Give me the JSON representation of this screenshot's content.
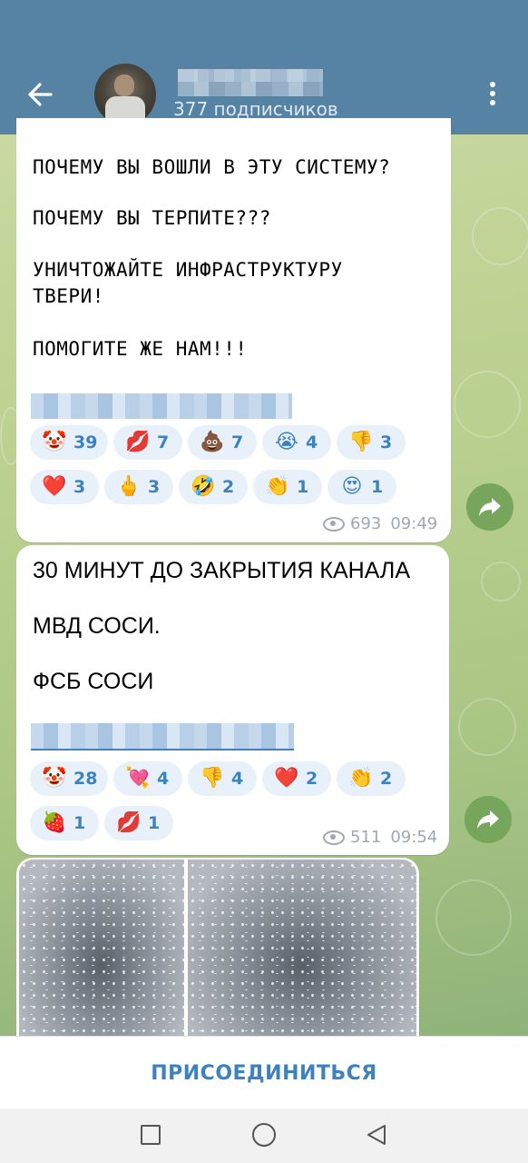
{
  "header": {
    "subscribers": "377 подписчиков",
    "back_icon": "arrow-left-icon",
    "menu_icon": "more-vertical-icon",
    "colors": {
      "header_bg": "#5682a3",
      "accent": "#3d82bf"
    }
  },
  "messages": [
    {
      "lines": [
        "ПОЧЕМУ ВЫ ВОШЛИ В ЭТУ СИСТЕМУ?",
        "ПОЧЕМУ ВЫ ТЕРПИТЕ???",
        "УНИЧТОЖАЙТЕ ИНФРАСТРУКТУРУ",
        "ТВЕРИ!",
        "ПОМОГИТЕ ЖЕ НАМ!!!"
      ],
      "reactions": [
        {
          "emoji": "🤡",
          "count": "39"
        },
        {
          "emoji": "💋",
          "count": "7"
        },
        {
          "emoji": "💩",
          "count": "7"
        },
        {
          "emoji": "😭",
          "count": "4"
        },
        {
          "emoji": "👎",
          "count": "3"
        },
        {
          "emoji": "❤️",
          "count": "3"
        },
        {
          "emoji": "🖕",
          "count": "3"
        },
        {
          "emoji": "🤣",
          "count": "2"
        },
        {
          "emoji": "👏",
          "count": "1"
        },
        {
          "emoji": "😍",
          "count": "1"
        }
      ],
      "views": "693",
      "time": "09:49"
    },
    {
      "lines": [
        "30 МИНУТ ДО ЗАКРЫТИЯ КАНАЛА",
        "МВД СОСИ.",
        "ФСБ СОСИ"
      ],
      "reactions": [
        {
          "emoji": "🤡",
          "count": "28"
        },
        {
          "emoji": "💘",
          "count": "4"
        },
        {
          "emoji": "👎",
          "count": "4"
        },
        {
          "emoji": "❤️",
          "count": "2"
        },
        {
          "emoji": "👏",
          "count": "2"
        },
        {
          "emoji": "🍓",
          "count": "1"
        },
        {
          "emoji": "💋",
          "count": "1"
        }
      ],
      "views": "511",
      "time": "09:54"
    }
  ],
  "join_button": "ПРИСОЕДИНИТЬСЯ",
  "nav": {
    "recents_icon": "square-icon",
    "home_icon": "circle-icon",
    "back_icon": "triangle-back-icon"
  }
}
